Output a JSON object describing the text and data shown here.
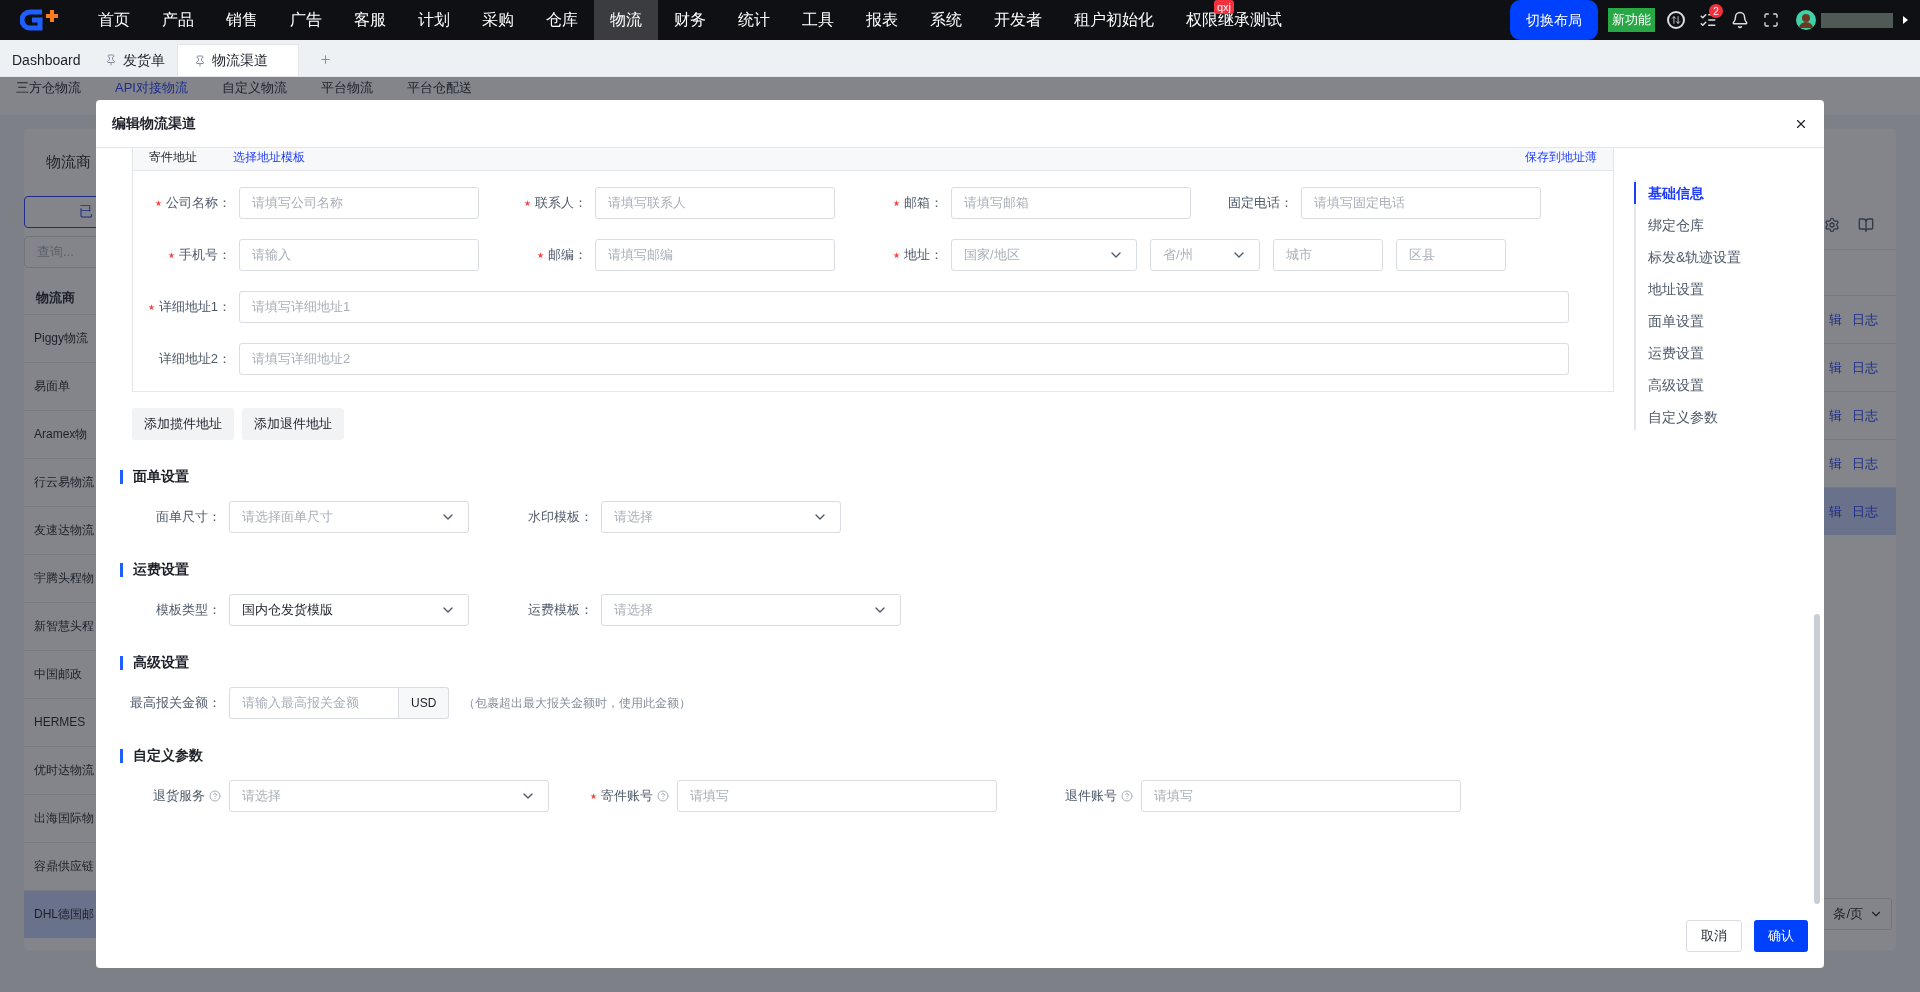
{
  "top_nav": {
    "menu": [
      {
        "label": "首页",
        "selected": false
      },
      {
        "label": "产品",
        "selected": false
      },
      {
        "label": "销售",
        "selected": false
      },
      {
        "label": "广告",
        "selected": false
      },
      {
        "label": "客服",
        "selected": false
      },
      {
        "label": "计划",
        "selected": false
      },
      {
        "label": "采购",
        "selected": false
      },
      {
        "label": "仓库",
        "selected": false
      },
      {
        "label": "物流",
        "selected": true
      },
      {
        "label": "财务",
        "selected": false
      },
      {
        "label": "统计",
        "selected": false
      },
      {
        "label": "工具",
        "selected": false
      },
      {
        "label": "报表",
        "selected": false
      },
      {
        "label": "系统",
        "selected": false
      },
      {
        "label": "开发者",
        "selected": false
      },
      {
        "label": "租户初始化",
        "selected": false
      },
      {
        "label": "权限继承测试",
        "selected": false,
        "badge": "qxj"
      }
    ],
    "switch_layout": "切换布局",
    "new_feature": "新功能",
    "tasks_badge": "2"
  },
  "tabs": [
    {
      "label": "Dashboard",
      "pinned": false,
      "selected": false
    },
    {
      "label": "发货单",
      "pinned": true,
      "selected": false
    },
    {
      "label": "物流渠道",
      "pinned": true,
      "selected": true
    }
  ],
  "sub_tabs": [
    {
      "label": "三方仓物流",
      "selected": false
    },
    {
      "label": "API对接物流",
      "selected": true
    },
    {
      "label": "自定义物流",
      "selected": false
    },
    {
      "label": "平台物流",
      "selected": false
    },
    {
      "label": "平台仓配送",
      "selected": false
    }
  ],
  "carrier_panel": {
    "title": "物流商",
    "filter_button": "已",
    "search_placeholder": "查询...",
    "column": "物流商",
    "rows": [
      {
        "name": "Piggy物流",
        "selected": false
      },
      {
        "name": "易面单",
        "selected": false
      },
      {
        "name": "Aramex物",
        "selected": false
      },
      {
        "name": "行云易物流",
        "selected": false
      },
      {
        "name": "友速达物流",
        "selected": false
      },
      {
        "name": "宇腾头程物",
        "selected": false
      },
      {
        "name": "新智慧头程",
        "selected": false
      },
      {
        "name": "中国邮政",
        "selected": false
      },
      {
        "name": "HERMES",
        "selected": false
      },
      {
        "name": "优时达物流",
        "selected": false
      },
      {
        "name": "出海国际物",
        "selected": false
      },
      {
        "name": "容鼎供应链",
        "selected": false
      },
      {
        "name": "DHL德国邮",
        "selected": true
      }
    ]
  },
  "channel_table": {
    "rows": [
      {
        "edit": "辑",
        "log": "日志",
        "selected": false
      },
      {
        "edit": "辑",
        "log": "日志",
        "selected": false
      },
      {
        "edit": "辑",
        "log": "日志",
        "selected": false
      },
      {
        "edit": "辑",
        "log": "日志",
        "selected": false
      },
      {
        "edit": "辑",
        "log": "日志",
        "selected": true
      }
    ],
    "page_size": "条/页"
  },
  "modal": {
    "title": "编辑物流渠道",
    "address": {
      "label": "寄件地址",
      "template_link": "选择地址模板",
      "save_link": "保存到地址薄",
      "rows": [
        [
          {
            "label": "公司名称：",
            "required": true,
            "controls": [
              {
                "kind": "input",
                "placeholder": "请填写公司名称"
              }
            ]
          },
          {
            "label": "联系人：",
            "required": true,
            "controls": [
              {
                "kind": "input",
                "placeholder": "请填写联系人"
              }
            ]
          },
          {
            "label": "邮箱：",
            "required": true,
            "controls": [
              {
                "kind": "input",
                "placeholder": "请填写邮箱"
              }
            ]
          },
          {
            "label": "固定电话：",
            "required": false,
            "controls": [
              {
                "kind": "input",
                "placeholder": "请填写固定电话"
              }
            ]
          }
        ],
        [
          {
            "label": "手机号：",
            "required": true,
            "controls": [
              {
                "kind": "input",
                "placeholder": "请输入"
              }
            ]
          },
          {
            "label": "邮编：",
            "required": true,
            "controls": [
              {
                "kind": "input",
                "placeholder": "请填写邮编"
              }
            ]
          },
          {
            "label": "地址：",
            "required": true,
            "controls": [
              {
                "kind": "select",
                "placeholder": "国家/地区"
              },
              {
                "kind": "select",
                "placeholder": "省/州"
              },
              {
                "kind": "input",
                "placeholder": "城市"
              },
              {
                "kind": "input",
                "placeholder": "区县"
              }
            ]
          }
        ],
        [
          {
            "label": "详细地址1：",
            "required": true,
            "controls": [
              {
                "kind": "input",
                "placeholder": "请填写详细地址1"
              }
            ]
          }
        ],
        [
          {
            "label": "详细地址2：",
            "required": false,
            "controls": [
              {
                "kind": "input",
                "placeholder": "请填写详细地址2"
              }
            ]
          }
        ]
      ]
    },
    "address_buttons": [
      "添加揽件地址",
      "添加退件地址"
    ],
    "sections": [
      {
        "title": "面单设置",
        "fields": [
          {
            "label": "面单尺寸：",
            "required": false,
            "kind": "select",
            "placeholder": "请选择面单尺寸"
          },
          {
            "label": "水印模板：",
            "required": false,
            "kind": "select",
            "placeholder": "请选择"
          }
        ]
      },
      {
        "title": "运费设置",
        "fields": [
          {
            "label": "模板类型：",
            "required": false,
            "kind": "select",
            "value": "国内仓发货模版"
          },
          {
            "label": "运费模板：",
            "required": false,
            "kind": "select",
            "placeholder": "请选择"
          }
        ]
      },
      {
        "title": "高级设置",
        "fields": [
          {
            "label": "最高报关金额：",
            "required": false,
            "kind": "addon",
            "placeholder": "请输入最高报关金额",
            "addon": "USD",
            "note": "（包裹超出最大报关金额时，使用此金额）"
          }
        ]
      },
      {
        "title": "自定义参数",
        "fields": [
          {
            "label": "退货服务",
            "required": false,
            "help": true,
            "kind": "select",
            "placeholder": "请选择"
          },
          {
            "label": "寄件账号",
            "required": true,
            "help": true,
            "kind": "input",
            "placeholder": "请填写"
          },
          {
            "label": "退件账号",
            "required": false,
            "help": true,
            "kind": "input",
            "placeholder": "请填写"
          }
        ]
      }
    ],
    "nav": [
      {
        "label": "基础信息",
        "selected": true
      },
      {
        "label": "绑定仓库",
        "selected": false
      },
      {
        "label": "标发&轨迹设置",
        "selected": false
      },
      {
        "label": "地址设置",
        "selected": false
      },
      {
        "label": "面单设置",
        "selected": false
      },
      {
        "label": "运费设置",
        "selected": false
      },
      {
        "label": "高级设置",
        "selected": false
      },
      {
        "label": "自定义参数",
        "selected": false
      }
    ],
    "cancel": "取消",
    "confirm": "确认"
  }
}
